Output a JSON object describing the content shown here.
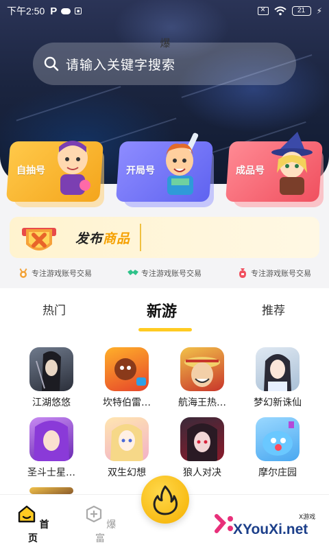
{
  "status_bar": {
    "time": "下午2:50",
    "p_icon": "P",
    "battery": "21",
    "sim_mark": "✕",
    "bolt": "⚡"
  },
  "search": {
    "placeholder": "请输入关键字搜索"
  },
  "categories": [
    {
      "label": "自抽号",
      "color": "#f4a51c"
    },
    {
      "label": "开局号",
      "color": "#5f63f0"
    },
    {
      "label": "成品号",
      "color": "#f0505f"
    }
  ],
  "publish": {
    "title_a": "发布",
    "title_b": "商品"
  },
  "features": [
    {
      "text": "专注游戏账号交易",
      "icon": "medal-icon",
      "color": "#f2a33a"
    },
    {
      "text": "专注游戏账号交易",
      "icon": "handshake-icon",
      "color": "#2fc28a"
    },
    {
      "text": "专注游戏账号交易",
      "icon": "moneybag-icon",
      "color": "#f0505f"
    }
  ],
  "tabs": [
    {
      "label": "热门"
    },
    {
      "label": "新游",
      "active": true
    },
    {
      "label": "推荐"
    }
  ],
  "games": [
    {
      "name": "江湖悠悠"
    },
    {
      "name": "坎特伯雷…"
    },
    {
      "name": "航海王热…"
    },
    {
      "name": "梦幻新诛仙"
    },
    {
      "name": "圣斗士星…"
    },
    {
      "name": "双生幻想"
    },
    {
      "name": "狼人对决"
    },
    {
      "name": "摩尔庄园"
    }
  ],
  "nav": {
    "home": "首页",
    "rich": "爆富",
    "boom": "爆"
  },
  "watermark": {
    "small": "X游戏",
    "main": "XYouXi.net"
  },
  "colors": {
    "accent": "#ffcb22",
    "brand_yellow": "#f5b000"
  }
}
